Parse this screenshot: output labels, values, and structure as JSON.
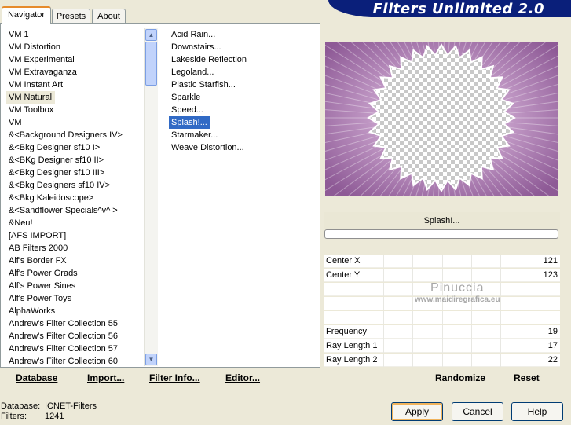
{
  "window": {
    "title": "Filters Unlimited 2.0"
  },
  "tabs": [
    {
      "label": "Navigator"
    },
    {
      "label": "Presets"
    },
    {
      "label": "About"
    }
  ],
  "categories": [
    "VM 1",
    "VM Distortion",
    "VM Experimental",
    "VM Extravaganza",
    "VM Instant Art",
    "VM Natural",
    "VM Toolbox",
    "VM",
    "&<Background Designers IV>",
    "&<Bkg Designer sf10 I>",
    "&<BKg Designer sf10 II>",
    "&<Bkg Designer sf10 III>",
    "&<Bkg Designers sf10 IV>",
    "&<Bkg Kaleidoscope>",
    "&<Sandflower Specials^v^ >",
    "&Neu!",
    "[AFS IMPORT]",
    "AB Filters 2000",
    "Alf's Border FX",
    "Alf's Power Grads",
    "Alf's Power Sines",
    "Alf's Power Toys",
    "AlphaWorks",
    "Andrew's Filter Collection 55",
    "Andrew's Filter Collection 56",
    "Andrew's Filter Collection 57",
    "Andrew's Filter Collection 60"
  ],
  "filters": [
    "Acid Rain...",
    "Downstairs...",
    "Lakeside Reflection",
    "Legoland...",
    "Plastic Starfish...",
    "Sparkle",
    "Speed...",
    "Splash!...",
    "Starmaker...",
    "Weave Distortion..."
  ],
  "left_buttons": {
    "database": "Database",
    "import": "Import...",
    "filter_info": "Filter Info...",
    "editor": "Editor..."
  },
  "filter_name": "Splash!...",
  "params": [
    {
      "label": "Center X",
      "value": "121"
    },
    {
      "label": "Center Y",
      "value": "123"
    },
    {
      "label": "",
      "value": ""
    },
    {
      "label": "",
      "value": ""
    },
    {
      "label": "",
      "value": ""
    },
    {
      "label": "Frequency",
      "value": "19"
    },
    {
      "label": "Ray Length 1",
      "value": "17"
    },
    {
      "label": "Ray Length 2",
      "value": "22"
    }
  ],
  "watermark": {
    "name": "Pinuccia",
    "site": "www.maidiregrafica.eu"
  },
  "right_buttons": {
    "randomize": "Randomize",
    "reset": "Reset"
  },
  "footer": {
    "database_label": "Database:",
    "database_value": "ICNET-Filters",
    "filters_label": "Filters:",
    "filters_value": "1241",
    "apply": "Apply",
    "cancel": "Cancel",
    "help": "Help"
  }
}
